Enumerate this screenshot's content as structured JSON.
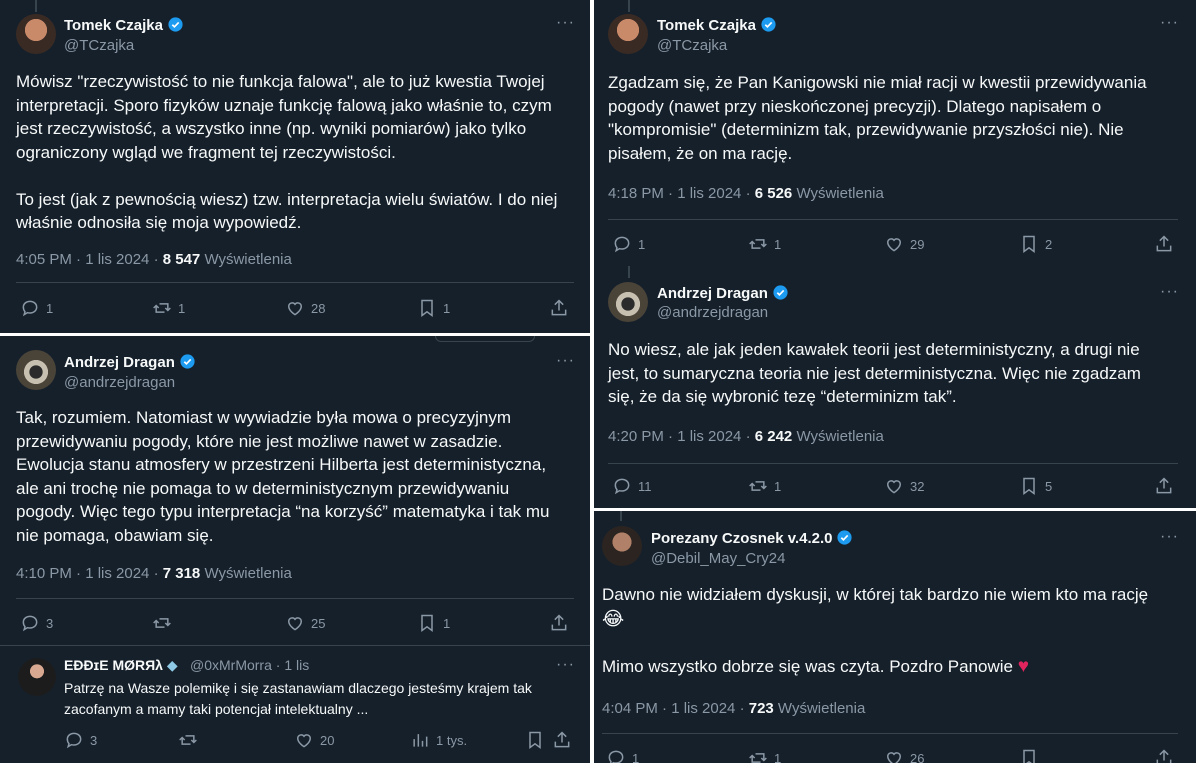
{
  "left": {
    "post1": {
      "name": "Tomek Czajka",
      "handle": "@TCzajka",
      "lines": [
        "Mówisz \"rzeczywistość to nie funkcja falowa\", ale to już kwestia Twojej",
        "interpretacji. Sporo fizyków uznaje funkcję falową jako właśnie to, czym",
        "jest rzeczywistość, a wszystko inne (np. wyniki pomiarów) jako tylko",
        "ograniczony wgląd we fragment tej rzeczywistości.",
        "",
        "To jest (jak z pewnością wiesz) tzw. interpretacja wielu światów. I do niej",
        "właśnie odnosiła się moja wypowiedź."
      ],
      "meta_time": "4:05 PM · 1 lis 2024 · ",
      "views": "8 547",
      "views_label": " Wyświetlenia",
      "replies": "1",
      "reposts": "1",
      "likes": "28",
      "bookmarks": "1"
    },
    "post2": {
      "name": "Andrzej Dragan",
      "handle": "@andrzejdragan",
      "lines": [
        "Tak, rozumiem. Natomiast w wywiadzie była mowa o precyzyjnym",
        "przewidywaniu pogody, które nie jest możliwe nawet w zasadzie.",
        "Ewolucja stanu atmosfery w przestrzeni Hilberta jest deterministyczna,",
        "ale ani trochę nie pomaga to w deterministycznym przewidywaniu",
        "pogody. Więc tego typu interpretacja “na korzyść” matematyka i tak mu",
        "nie pomaga, obawiam się."
      ],
      "meta_time": "4:10 PM · 1 lis 2024 · ",
      "views": "7 318",
      "views_label": " Wyświetlenia",
      "replies": "3",
      "reposts": "",
      "likes": "25",
      "bookmarks": "1"
    },
    "reply": {
      "name": "EÐÐɪE MØRЯλ",
      "handle": "@0xMrMorra · 1 lis",
      "lines": [
        "Patrzę na Wasze polemikę i się zastanawiam dlaczego jesteśmy krajem tak",
        "zacofanym a mamy taki potencjał intelektualny ..."
      ],
      "replies": "3",
      "reposts": "",
      "likes": "20",
      "views": "1 tys.",
      "bookmarks": ""
    }
  },
  "right": {
    "post1": {
      "name": "Tomek Czajka",
      "handle": "@TCzajka",
      "lines": [
        "Zgadzam się, że Pan Kanigowski nie miał racji w kwestii przewidywania",
        "pogody (nawet przy nieskończonej precyzji). Dlatego napisałem o",
        "\"kompromisie\" (determinizm tak, przewidywanie przyszłości nie). Nie",
        "pisałem, że on ma rację."
      ],
      "meta_time": "4:18 PM · 1 lis 2024 · ",
      "views": "6 526",
      "views_label": " Wyświetlenia",
      "replies": "1",
      "reposts": "1",
      "likes": "29",
      "bookmarks": "2"
    },
    "post2": {
      "name": "Andrzej Dragan",
      "handle": "@andrzejdragan",
      "lines": [
        "No wiesz, ale jak jeden kawałek teorii jest deterministyczny, a drugi nie",
        "jest, to sumaryczna teoria nie jest deterministyczna. Więc nie zgadzam",
        "się, że da się wybronić tezę “determinizm tak”."
      ],
      "meta_time": "4:20 PM · 1 lis 2024 · ",
      "views": "6 242",
      "views_label": " Wyświetlenia",
      "replies": "11",
      "reposts": "1",
      "likes": "32",
      "bookmarks": "5"
    },
    "post3": {
      "name": "Porezany Czosnek v.4.2.0",
      "handle": "@Debil_May_Cry24",
      "line1": "Dawno nie widziałem dyskusji, w której tak bardzo nie wiem kto ma rację",
      "emoji1": "😂",
      "line2": "Mimo wszystko dobrze się was czyta. Pozdro Panowie",
      "meta_time": "4:04 PM · 1 lis 2024 · ",
      "views": "723",
      "views_label": " Wyświetlenia",
      "replies": "1",
      "reposts": "1",
      "likes": "26",
      "bookmarks": ""
    }
  },
  "colors": {
    "background": "#15202b",
    "text": "#f7f9f9",
    "muted": "#8b98a5",
    "verified": "#1d9bf0",
    "heart": "#f91880"
  },
  "icons": [
    "verified-badge-icon",
    "more-icon",
    "reply-icon",
    "repost-icon",
    "like-icon",
    "bookmark-icon",
    "share-icon",
    "views-icon"
  ]
}
